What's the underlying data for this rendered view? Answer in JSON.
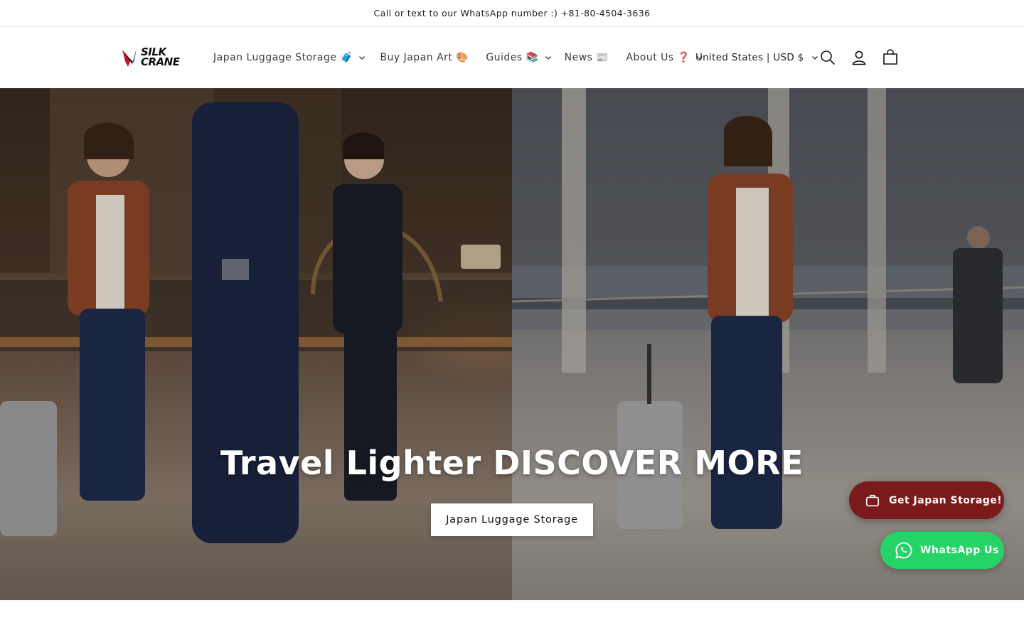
{
  "announcement": {
    "text": "Call or text to our WhatsApp number :) +81-80-4504-3636"
  },
  "header": {
    "logo_text_line1": "SILK",
    "logo_text_line2": "CRANE",
    "nav": [
      {
        "label": "Japan Luggage Storage 🧳",
        "has_dropdown": true
      },
      {
        "label": "Buy Japan Art 🎨",
        "has_dropdown": false
      },
      {
        "label": "Guides 📚",
        "has_dropdown": true
      },
      {
        "label": "News 📰",
        "has_dropdown": false
      },
      {
        "label": "About Us ❓",
        "has_dropdown": true
      }
    ],
    "locale": "United States | USD $",
    "icons": [
      "search-icon",
      "account-icon",
      "cart-icon"
    ]
  },
  "hero": {
    "title": "Travel Lighter DISCOVER MORE",
    "button_label": "Japan Luggage Storage"
  },
  "floating": {
    "storage_label": "Get Japan Storage!",
    "whatsapp_label": "WhatsApp Us",
    "storage_color": "#7a1a1a",
    "whatsapp_color": "#25d366"
  }
}
